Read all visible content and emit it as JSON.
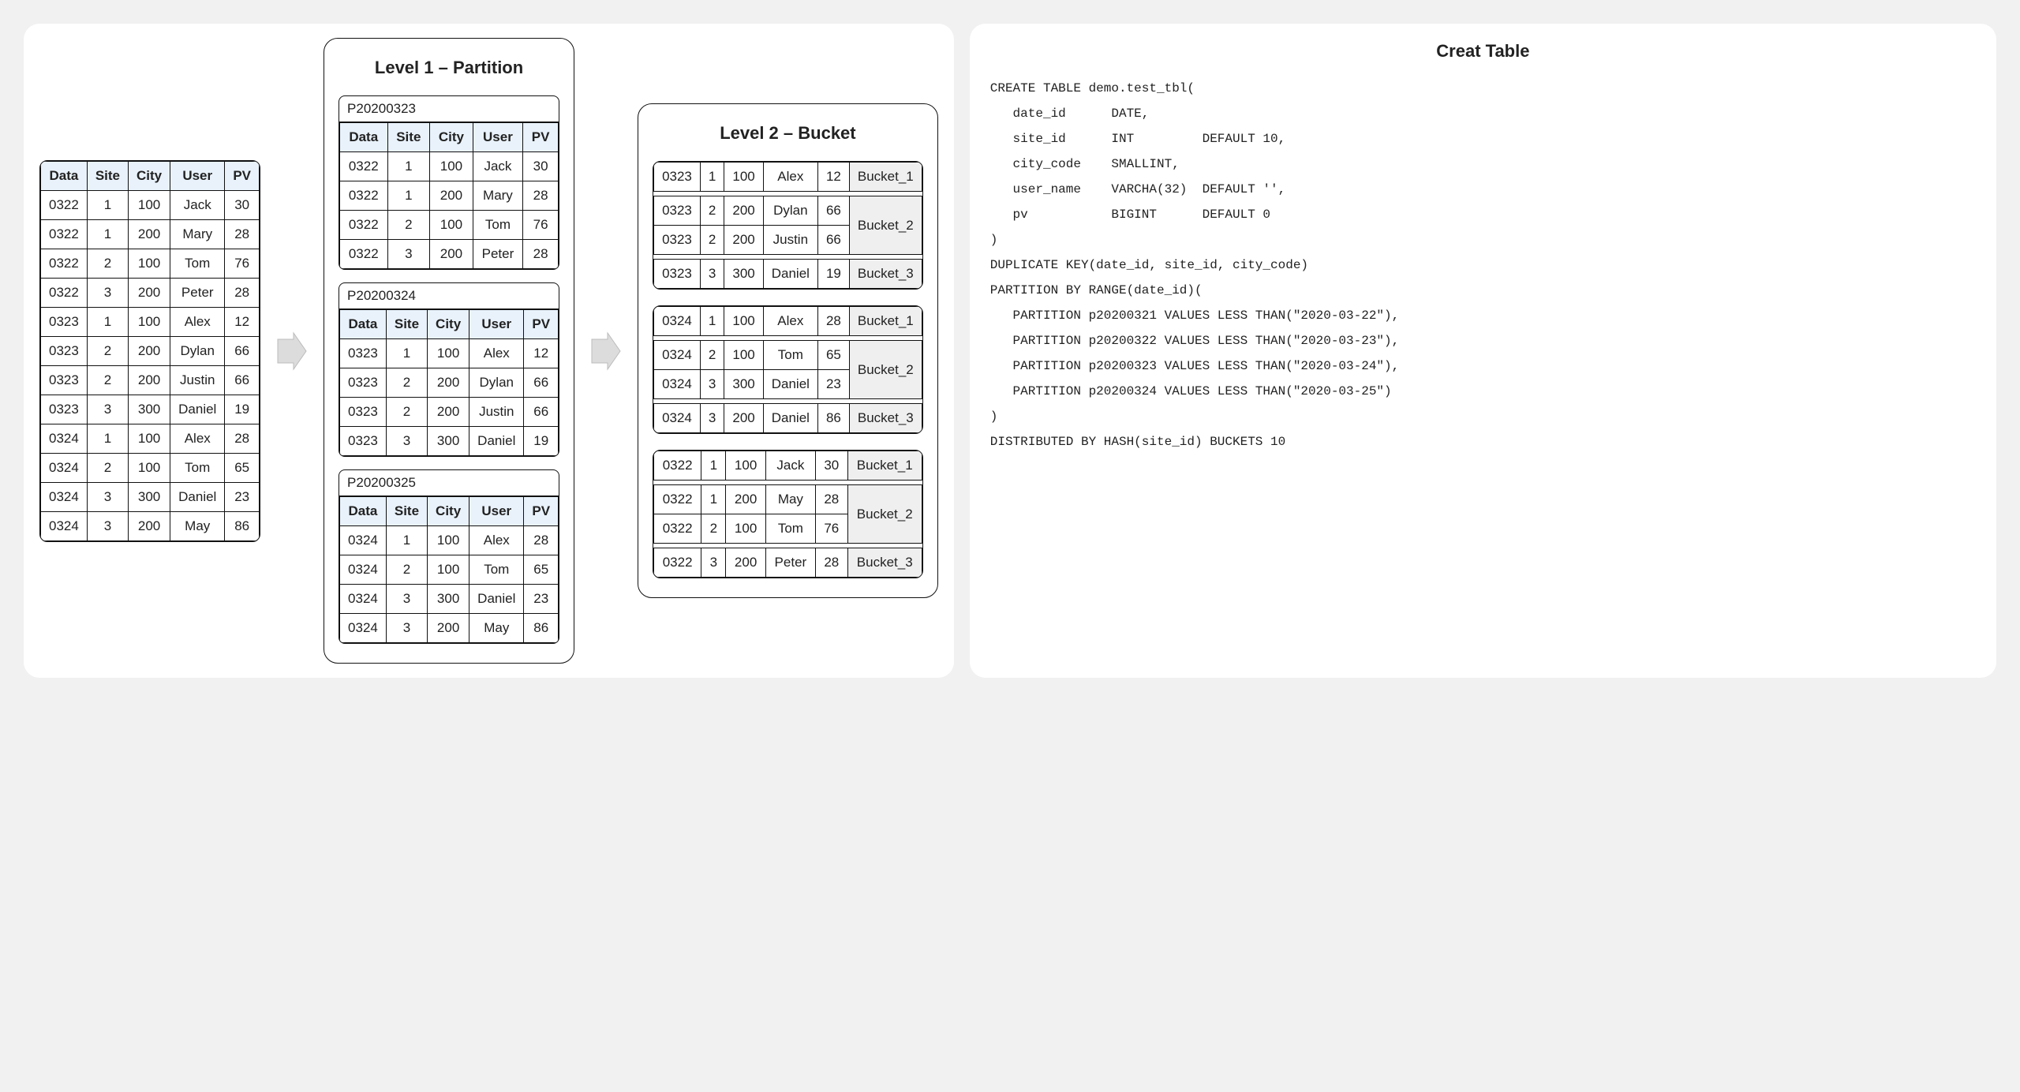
{
  "source_table": {
    "headers": [
      "Data",
      "Site",
      "City",
      "User",
      "PV"
    ],
    "rows": [
      [
        "0322",
        "1",
        "100",
        "Jack",
        "30"
      ],
      [
        "0322",
        "1",
        "200",
        "Mary",
        "28"
      ],
      [
        "0322",
        "2",
        "100",
        "Tom",
        "76"
      ],
      [
        "0322",
        "3",
        "200",
        "Peter",
        "28"
      ],
      [
        "0323",
        "1",
        "100",
        "Alex",
        "12"
      ],
      [
        "0323",
        "2",
        "200",
        "Dylan",
        "66"
      ],
      [
        "0323",
        "2",
        "200",
        "Justin",
        "66"
      ],
      [
        "0323",
        "3",
        "300",
        "Daniel",
        "19"
      ],
      [
        "0324",
        "1",
        "100",
        "Alex",
        "28"
      ],
      [
        "0324",
        "2",
        "100",
        "Tom",
        "65"
      ],
      [
        "0324",
        "3",
        "300",
        "Daniel",
        "23"
      ],
      [
        "0324",
        "3",
        "200",
        "May",
        "86"
      ]
    ]
  },
  "level1": {
    "title": "Level 1 – Partition",
    "headers": [
      "Data",
      "Site",
      "City",
      "User",
      "PV"
    ],
    "partitions": [
      {
        "label": "P20200323",
        "rows": [
          [
            "0322",
            "1",
            "100",
            "Jack",
            "30"
          ],
          [
            "0322",
            "1",
            "200",
            "Mary",
            "28"
          ],
          [
            "0322",
            "2",
            "100",
            "Tom",
            "76"
          ],
          [
            "0322",
            "3",
            "200",
            "Peter",
            "28"
          ]
        ]
      },
      {
        "label": "P20200324",
        "rows": [
          [
            "0323",
            "1",
            "100",
            "Alex",
            "12"
          ],
          [
            "0323",
            "2",
            "200",
            "Dylan",
            "66"
          ],
          [
            "0323",
            "2",
            "200",
            "Justin",
            "66"
          ],
          [
            "0323",
            "3",
            "300",
            "Daniel",
            "19"
          ]
        ]
      },
      {
        "label": "P20200325",
        "rows": [
          [
            "0324",
            "1",
            "100",
            "Alex",
            "28"
          ],
          [
            "0324",
            "2",
            "100",
            "Tom",
            "65"
          ],
          [
            "0324",
            "3",
            "300",
            "Daniel",
            "23"
          ],
          [
            "0324",
            "3",
            "200",
            "May",
            "86"
          ]
        ]
      }
    ]
  },
  "level2": {
    "title": "Level 2 – Bucket",
    "groups": [
      {
        "buckets": [
          {
            "label": "Bucket_1",
            "rows": [
              [
                "0323",
                "1",
                "100",
                "Alex",
                "12"
              ]
            ]
          },
          {
            "label": "Bucket_2",
            "rows": [
              [
                "0323",
                "2",
                "200",
                "Dylan",
                "66"
              ],
              [
                "0323",
                "2",
                "200",
                "Justin",
                "66"
              ]
            ]
          },
          {
            "label": "Bucket_3",
            "rows": [
              [
                "0323",
                "3",
                "300",
                "Daniel",
                "19"
              ]
            ]
          }
        ]
      },
      {
        "buckets": [
          {
            "label": "Bucket_1",
            "rows": [
              [
                "0324",
                "1",
                "100",
                "Alex",
                "28"
              ]
            ]
          },
          {
            "label": "Bucket_2",
            "rows": [
              [
                "0324",
                "2",
                "100",
                "Tom",
                "65"
              ],
              [
                "0324",
                "3",
                "300",
                "Daniel",
                "23"
              ]
            ]
          },
          {
            "label": "Bucket_3",
            "rows": [
              [
                "0324",
                "3",
                "200",
                "Daniel",
                "86"
              ]
            ]
          }
        ]
      },
      {
        "buckets": [
          {
            "label": "Bucket_1",
            "rows": [
              [
                "0322",
                "1",
                "100",
                "Jack",
                "30"
              ]
            ]
          },
          {
            "label": "Bucket_2",
            "rows": [
              [
                "0322",
                "1",
                "200",
                "May",
                "28"
              ],
              [
                "0322",
                "2",
                "100",
                "Tom",
                "76"
              ]
            ]
          },
          {
            "label": "Bucket_3",
            "rows": [
              [
                "0322",
                "3",
                "200",
                "Peter",
                "28"
              ]
            ]
          }
        ]
      }
    ]
  },
  "code": {
    "title": "Creat Table",
    "text": "CREATE TABLE demo.test_tbl(\n   date_id      DATE,\n   site_id      INT         DEFAULT 10,\n   city_code    SMALLINT,\n   user_name    VARCHA(32)  DEFAULT '',\n   pv           BIGINT      DEFAULT 0\n)\nDUPLICATE KEY(date_id, site_id, city_code)\nPARTITION BY RANGE(date_id)(\n   PARTITION p20200321 VALUES LESS THAN(\"2020-03-22\"),\n   PARTITION p20200322 VALUES LESS THAN(\"2020-03-23\"),\n   PARTITION p20200323 VALUES LESS THAN(\"2020-03-24\"),\n   PARTITION p20200324 VALUES LESS THAN(\"2020-03-25\")\n)\nDISTRIBUTED BY HASH(site_id) BUCKETS 10"
  }
}
